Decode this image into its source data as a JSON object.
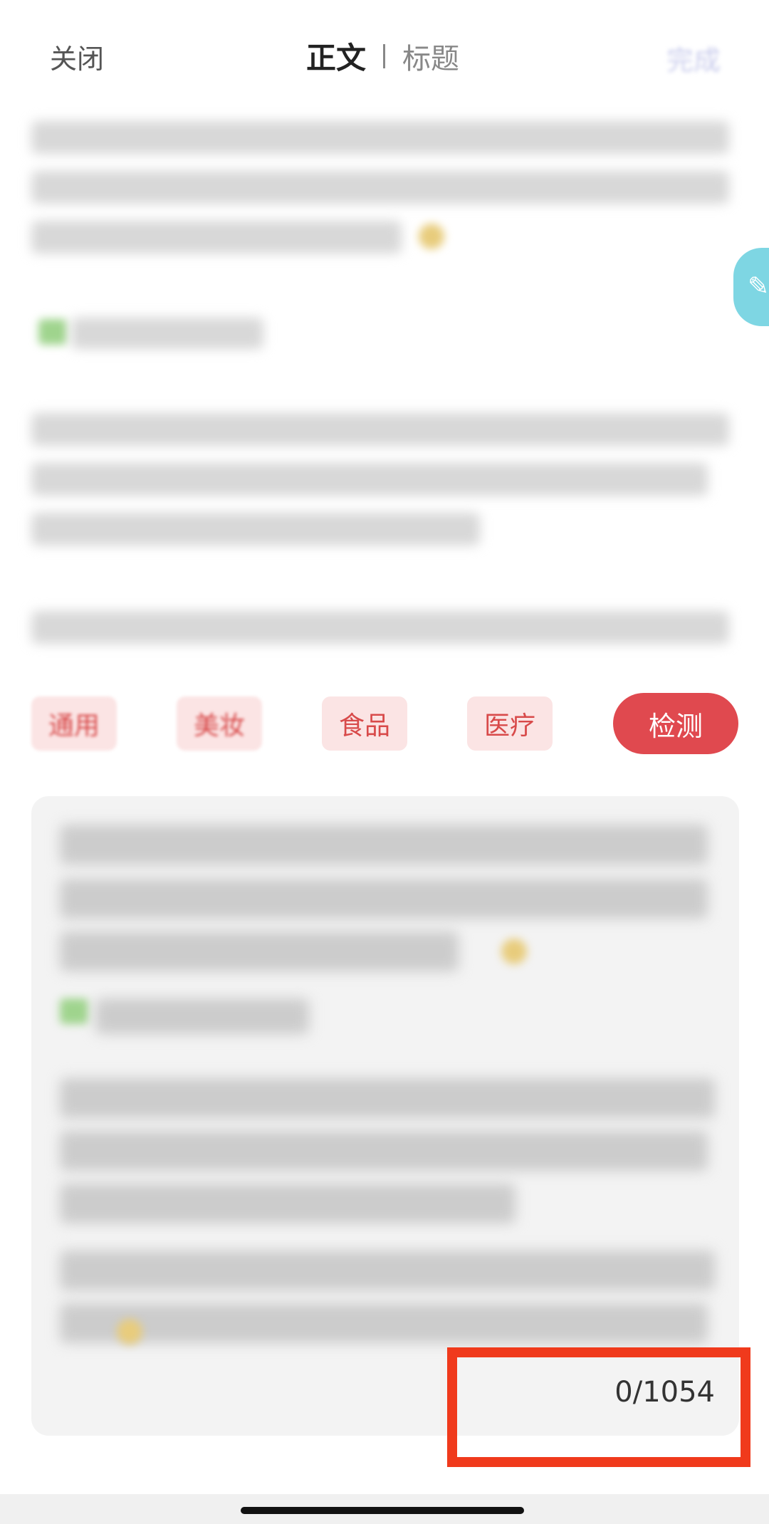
{
  "header": {
    "close_label": "关闭",
    "tab_body_label": "正文",
    "tab_title_label": "标题",
    "done_label": "完成"
  },
  "categories": [
    {
      "label": "通用"
    },
    {
      "label": "美妆"
    },
    {
      "label": "食品"
    },
    {
      "label": "医疗"
    },
    {
      "label": "检测"
    }
  ],
  "editor": {
    "char_count": "0/1054"
  },
  "icons": {
    "edit": "pencil-icon"
  },
  "colors": {
    "accent": "#e0494f",
    "chip_bg": "#fbe4e4",
    "highlight_box": "#f03a1c",
    "fab": "#7ed6e3"
  }
}
